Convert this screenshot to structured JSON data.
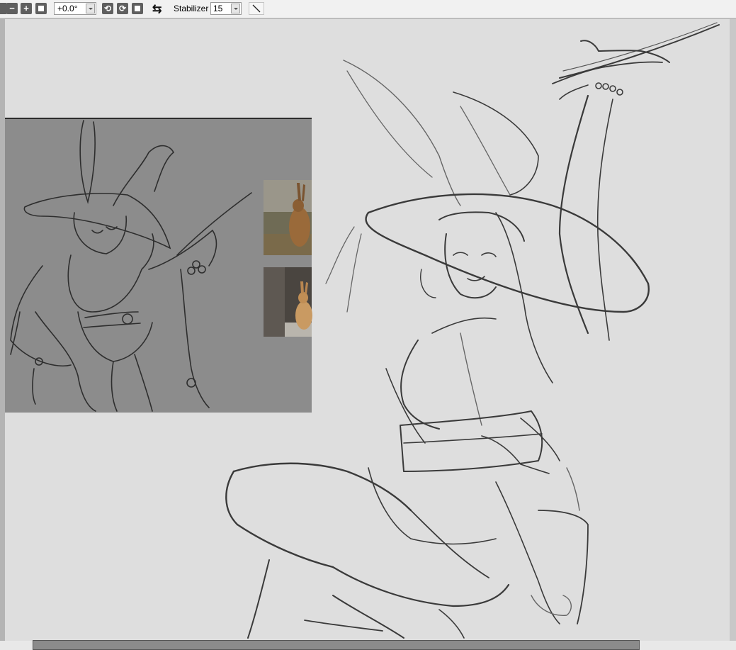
{
  "toolbar": {
    "buttons": [
      "zoom-out",
      "zoom-in",
      "fit-view"
    ],
    "rotation_value": "+0.0°",
    "rotation_actions": [
      "rotate-left",
      "rotate-right",
      "reset-rotation"
    ],
    "flip_icon": "⇆",
    "stabilizer_label": "Stabilizer",
    "stabilizer_value": "15",
    "pen_tool": "line"
  },
  "canvas": {
    "background": "#dedede",
    "reference_panel_background": "#8c8c8c",
    "sketch_stroke": "#3a3a3a",
    "reference_photos": [
      "brown-hare",
      "tan-rabbit"
    ]
  },
  "icons": {
    "minus": "−",
    "plus": "+",
    "rotate_left": "⟲",
    "rotate_right": "⟳",
    "flip": "⇆",
    "line": "╲"
  }
}
